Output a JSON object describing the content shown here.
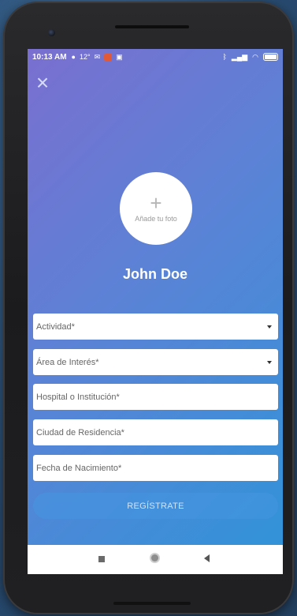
{
  "status_bar": {
    "time": "10:13 AM",
    "notification_icons": [
      "whatsapp-icon",
      "temperature",
      "email-icon",
      "app-icon",
      "gallery-icon"
    ],
    "temperature": "12°",
    "right_icons": [
      "bluetooth-icon",
      "signal-icon",
      "wifi-icon",
      "battery-icon"
    ]
  },
  "header": {
    "close_icon": "close-icon"
  },
  "profile": {
    "photo_label": "Añade tu foto",
    "name": "John Doe"
  },
  "form": {
    "activity_placeholder": "Actividad*",
    "interest_area_placeholder": "Área de Interés*",
    "institution_placeholder": "Hospital o Institución*",
    "city_placeholder": "Ciudad de Residencia*",
    "birthdate_placeholder": "Fecha de Nacimiento*",
    "submit_label": "REGÍSTRATE"
  },
  "navbar": {
    "icons": [
      "recent-apps-icon",
      "home-icon",
      "back-icon"
    ]
  },
  "colors": {
    "gradient_start": "#7a6fd0",
    "gradient_end": "#2f94d8",
    "button": "#4696e1"
  }
}
